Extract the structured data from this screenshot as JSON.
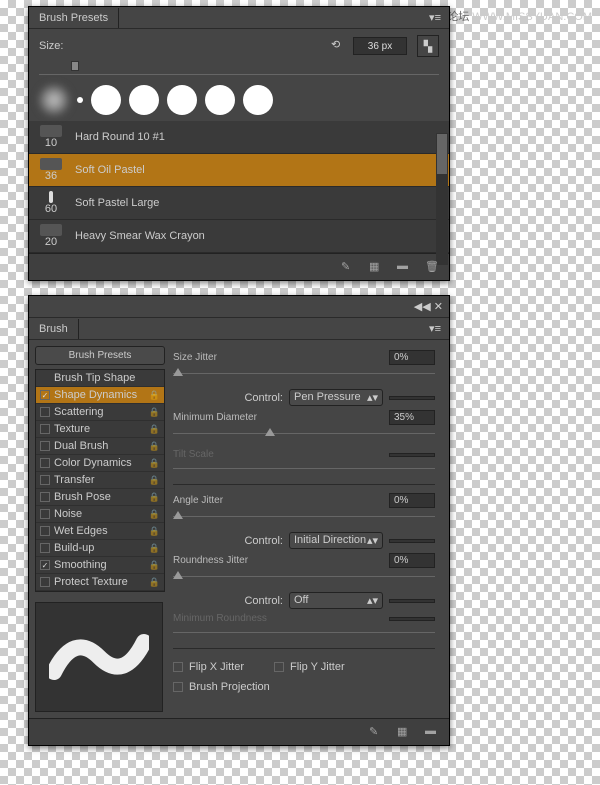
{
  "watermark": {
    "main": "思缘设计论坛",
    "url": "WWW.MISSYUAN.COM"
  },
  "presets_panel": {
    "title": "Brush Presets",
    "size_label": "Size:",
    "size_value": "36 px",
    "brushes": [
      {
        "name": "Hard Round 10 #1",
        "size": "10"
      },
      {
        "name": "Soft Oil Pastel",
        "size": "36"
      },
      {
        "name": "Soft Pastel Large",
        "size": "60"
      },
      {
        "name": "Heavy Smear Wax Crayon",
        "size": "20"
      }
    ]
  },
  "brush_panel": {
    "title": "Brush",
    "presets_btn": "Brush Presets",
    "tip_shape": "Brush Tip Shape",
    "options": [
      {
        "label": "Shape Dynamics",
        "checked": true,
        "selected": true,
        "enabled": true
      },
      {
        "label": "Scattering",
        "checked": false,
        "enabled": true
      },
      {
        "label": "Texture",
        "checked": false,
        "enabled": false
      },
      {
        "label": "Dual Brush",
        "checked": false,
        "enabled": false
      },
      {
        "label": "Color Dynamics",
        "checked": false,
        "enabled": false
      },
      {
        "label": "Transfer",
        "checked": false,
        "enabled": true
      },
      {
        "label": "Brush Pose",
        "checked": false,
        "enabled": true
      },
      {
        "label": "Noise",
        "checked": false,
        "enabled": true
      },
      {
        "label": "Wet Edges",
        "checked": false,
        "enabled": false
      },
      {
        "label": "Build-up",
        "checked": false,
        "enabled": false
      },
      {
        "label": "Smoothing",
        "checked": true,
        "enabled": true
      },
      {
        "label": "Protect Texture",
        "checked": false,
        "enabled": false
      }
    ],
    "controls": {
      "size_jitter": {
        "label": "Size Jitter",
        "value": "0%",
        "pos": 0
      },
      "size_control": {
        "label": "Control:",
        "value": "Pen Pressure"
      },
      "min_diameter": {
        "label": "Minimum Diameter",
        "value": "35%",
        "pos": 35
      },
      "tilt_scale": {
        "label": "Tilt Scale",
        "value": ""
      },
      "angle_jitter": {
        "label": "Angle Jitter",
        "value": "0%",
        "pos": 0
      },
      "angle_control": {
        "label": "Control:",
        "value": "Initial Direction"
      },
      "roundness_jitter": {
        "label": "Roundness Jitter",
        "value": "0%",
        "pos": 0
      },
      "roundness_control": {
        "label": "Control:",
        "value": "Off"
      },
      "min_roundness": {
        "label": "Minimum Roundness",
        "value": ""
      },
      "flip_x": "Flip X Jitter",
      "flip_y": "Flip Y Jitter",
      "brush_proj": "Brush Projection"
    }
  }
}
